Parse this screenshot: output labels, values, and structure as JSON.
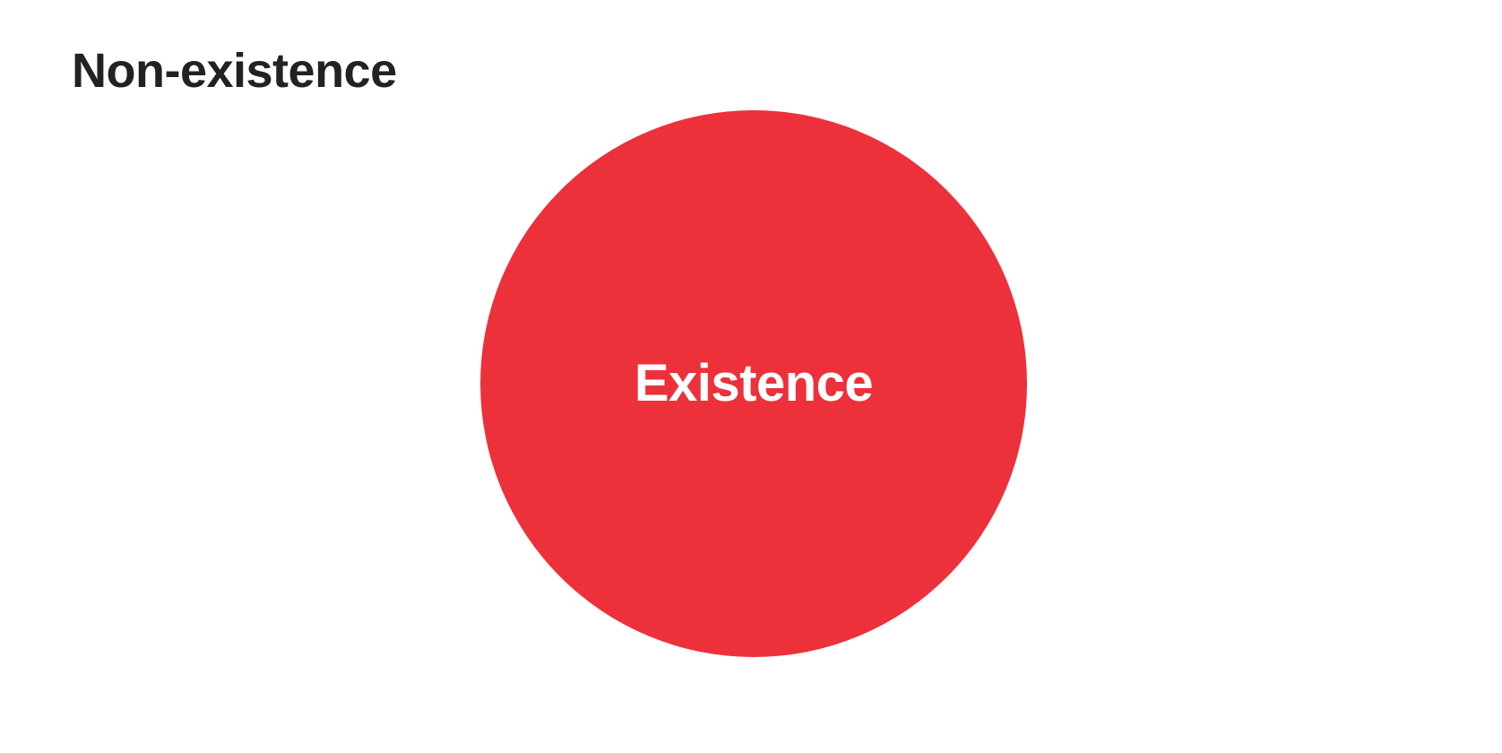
{
  "diagram": {
    "outer_label": "Non-existence",
    "inner_label": "Existence",
    "circle_color": "#ec313b",
    "outer_text_color": "#222222",
    "inner_text_color": "#ffffff",
    "background_color": "#ffffff"
  }
}
